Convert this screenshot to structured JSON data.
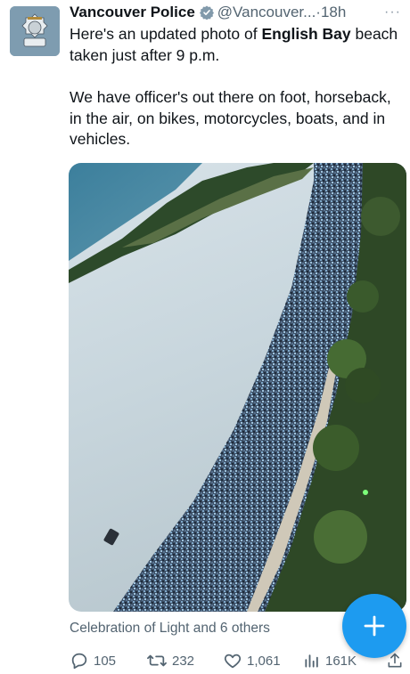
{
  "tweet": {
    "author_name": "Vancouver Police",
    "handle": "@Vancouver...",
    "separator": "·",
    "time": "18h",
    "more_label": "···",
    "text_line1_pre": "Here's an updated photo of ",
    "text_line1_bold": "English Bay",
    "text_line1_post": " beach taken just after 9 p.m.",
    "text_para2": "We have officer's out there on foot, horseback, in the air, on bikes, motorcycles, boats, and in vehicles.",
    "caption": "Celebration of Light and 6 others"
  },
  "actions": {
    "replies": "105",
    "retweets": "232",
    "likes": "1,061",
    "views": "161K"
  },
  "icons": {
    "avatar": "police-badge-icon",
    "verified": "verified-badge-icon",
    "reply": "reply-icon",
    "retweet": "retweet-icon",
    "like": "heart-icon",
    "views": "views-chart-icon",
    "share": "share-icon",
    "compose": "plus-icon"
  },
  "colors": {
    "accent": "#1d9bf0",
    "secondary_text": "#536471",
    "primary_text": "#0f1419"
  }
}
